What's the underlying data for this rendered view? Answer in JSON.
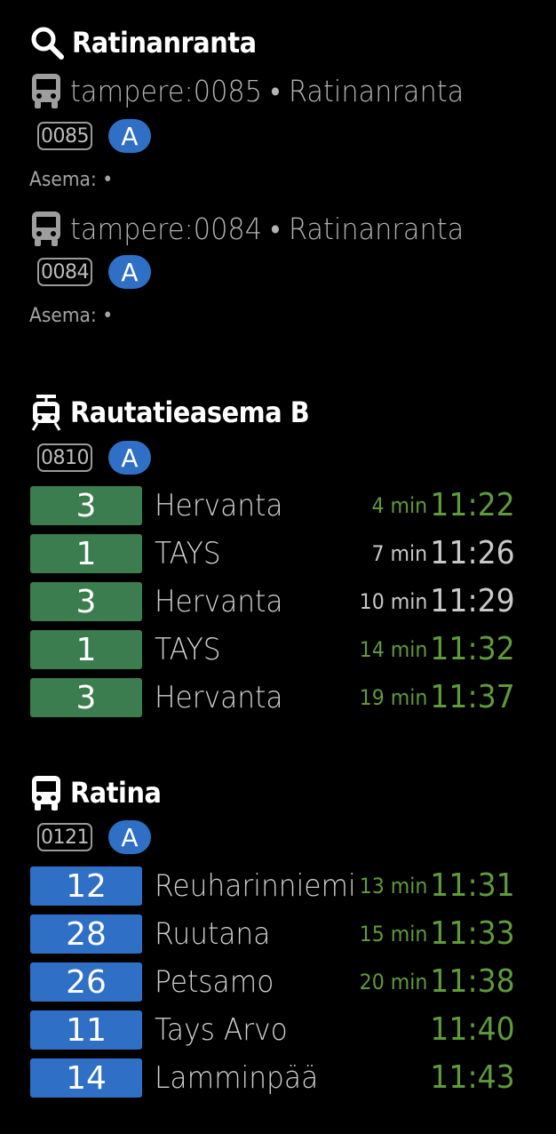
{
  "colors": {
    "tram": "#3b7d4e",
    "bus": "#2f6fc5",
    "realtime": "#5f9a3b",
    "scheduled": "#c8c8c8"
  },
  "search": {
    "title": "Ratinanranta",
    "stops": [
      {
        "label": "tampere:0085 • Ratinanranta",
        "code": "0085",
        "zone": "A",
        "asema": "Asema: •"
      },
      {
        "label": "tampere:0084 • Ratinanranta",
        "code": "0084",
        "zone": "A",
        "asema": "Asema: •"
      }
    ]
  },
  "stations": [
    {
      "title": "Rautatieasema B",
      "icon": "tram-icon",
      "code": "0810",
      "zone": "A",
      "departures": [
        {
          "route": "3",
          "dest": "Hervanta",
          "mins": "4 min",
          "time": "11:22",
          "realtime": true,
          "mode": "tram"
        },
        {
          "route": "1",
          "dest": "TAYS",
          "mins": "7 min",
          "time": "11:26",
          "realtime": false,
          "mode": "tram"
        },
        {
          "route": "3",
          "dest": "Hervanta",
          "mins": "10 min",
          "time": "11:29",
          "realtime": false,
          "mode": "tram"
        },
        {
          "route": "1",
          "dest": "TAYS",
          "mins": "14 min",
          "time": "11:32",
          "realtime": true,
          "mode": "tram"
        },
        {
          "route": "3",
          "dest": "Hervanta",
          "mins": "19 min",
          "time": "11:37",
          "realtime": true,
          "mode": "tram"
        }
      ]
    },
    {
      "title": "Ratina",
      "icon": "bus-icon",
      "code": "0121",
      "zone": "A",
      "departures": [
        {
          "route": "12",
          "dest": "Reuharinniemi",
          "mins": "13 min",
          "time": "11:31",
          "realtime": true,
          "mode": "bus"
        },
        {
          "route": "28",
          "dest": "Ruutana",
          "mins": "15 min",
          "time": "11:33",
          "realtime": true,
          "mode": "bus"
        },
        {
          "route": "26",
          "dest": "Petsamo",
          "mins": "20 min",
          "time": "11:38",
          "realtime": true,
          "mode": "bus"
        },
        {
          "route": "11",
          "dest": "Tays Arvo",
          "mins": "",
          "time": "11:40",
          "realtime": true,
          "mode": "bus"
        },
        {
          "route": "14",
          "dest": "Lamminpää",
          "mins": "",
          "time": "11:43",
          "realtime": true,
          "mode": "bus"
        }
      ]
    }
  ]
}
